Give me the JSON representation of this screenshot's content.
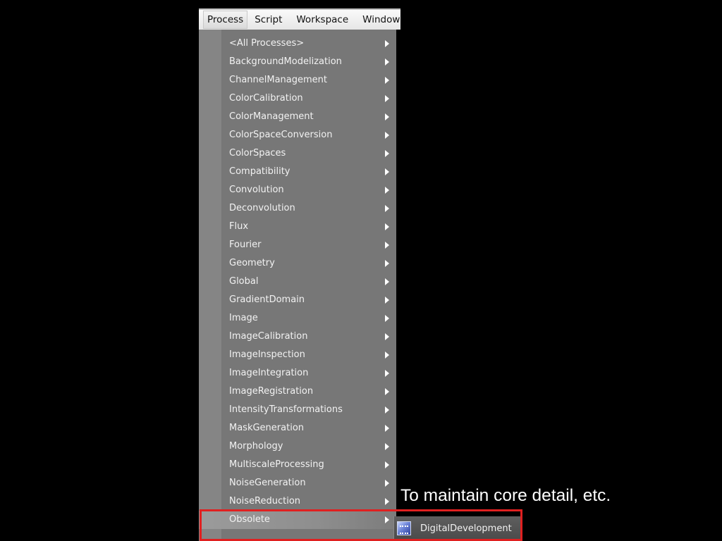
{
  "menubar": {
    "items": [
      {
        "label": "Process",
        "active": true
      },
      {
        "label": "Script",
        "active": false
      },
      {
        "label": "Workspace",
        "active": false
      },
      {
        "label": "Window",
        "active": false
      }
    ]
  },
  "process_menu": {
    "items": [
      {
        "label": "<All Processes>"
      },
      {
        "label": "BackgroundModelization"
      },
      {
        "label": "ChannelManagement"
      },
      {
        "label": "ColorCalibration"
      },
      {
        "label": "ColorManagement"
      },
      {
        "label": "ColorSpaceConversion"
      },
      {
        "label": "ColorSpaces"
      },
      {
        "label": "Compatibility"
      },
      {
        "label": "Convolution"
      },
      {
        "label": "Deconvolution"
      },
      {
        "label": "Flux"
      },
      {
        "label": "Fourier"
      },
      {
        "label": "Geometry"
      },
      {
        "label": "Global"
      },
      {
        "label": "GradientDomain"
      },
      {
        "label": "Image"
      },
      {
        "label": "ImageCalibration"
      },
      {
        "label": "ImageInspection"
      },
      {
        "label": "ImageIntegration"
      },
      {
        "label": "ImageRegistration"
      },
      {
        "label": "IntensityTransformations"
      },
      {
        "label": "MaskGeneration"
      },
      {
        "label": "Morphology"
      },
      {
        "label": "MultiscaleProcessing"
      },
      {
        "label": "NoiseGeneration"
      },
      {
        "label": "NoiseReduction"
      },
      {
        "label": "Obsolete",
        "highlighted": true
      }
    ]
  },
  "submenu": {
    "items": [
      {
        "label": "DigitalDevelopment",
        "icon": "digital-development-icon"
      }
    ]
  },
  "caption": "To maintain core detail, etc.",
  "colors": {
    "highlight_border": "#e02020",
    "menu_background": "#777777",
    "screen_background": "#000000"
  }
}
